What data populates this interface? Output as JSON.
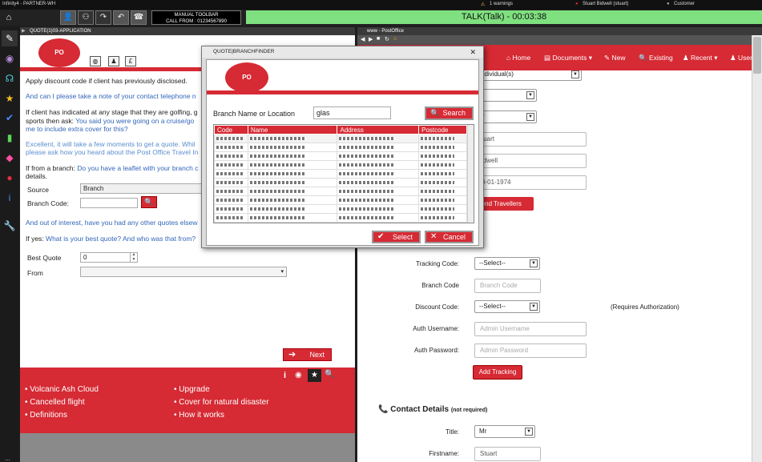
{
  "topbar": {
    "app_title": "Infinity4 - PARTNER-WH",
    "warnings": "1 warnings",
    "user": "Stuart Bidwell (stuart)",
    "customer": "Customer"
  },
  "toolbar": {
    "manual_label": "MANUAL TOOLBAR",
    "call_from": "CALL FROM : 01234567890",
    "talk_status": "TALK(Talk) - 00:03:38"
  },
  "left_panel": {
    "tab_title": "QUOTE(1)03-APPLICATION",
    "currency_icon": "£",
    "paragraphs": {
      "p1": "Apply discount code if client has previously disclosed.",
      "p2": "And can I please take a note of your contact telephone n",
      "p3a": "If client has indicated at any stage that they are golfing, g",
      "p3b": "sports then ask: ",
      "p3c": "You said you were going on a cruise/go",
      "p3d": "me to include extra cover for this?",
      "p4a": "Excellent, it will take a few moments to get a quote.  Whil",
      "p4b": "please ask how you heard about the Post Office Travel In",
      "p5a": "If from a branch: ",
      "p5b": "Do you have a leaflet with your branch c",
      "p5c": "details.",
      "p6": "And out of interest, have you had any other quotes elsew",
      "p7a": "If yes: ",
      "p7b": "What is your best quote?  And who was that from?"
    },
    "source_label": "Source",
    "source_value": "Branch",
    "branch_code_label": "Branch Code:",
    "best_quote_label": "Best Quote",
    "best_quote_value": "0",
    "from_label": "From",
    "next_label": "Next",
    "footer_left": [
      "Volcanic Ash Cloud",
      "Cancelled flight",
      "Definitions"
    ],
    "footer_right": [
      "Upgrade",
      "Cover for natural disaster",
      "How it works"
    ]
  },
  "right_panel": {
    "tab_title": "www - PostOffice",
    "nav": {
      "home": "Home",
      "documents": "Documents",
      "new": "New",
      "existing": "Existing",
      "recent": "Recent",
      "user": "User"
    },
    "top_fields": {
      "individual": "ndividual(s)",
      "title_short": "Ir",
      "firstname": "tuart",
      "surname": "idwell",
      "dob": "0-01-1974",
      "amend_travellers": "mend Travellers"
    },
    "tracking_code_label": "Tracking Code:",
    "tracking_code_value": "--Select--",
    "branch_code_label": "Branch Code",
    "branch_code_placeholder": "Branch Code",
    "discount_code_label": "Discount Code:",
    "discount_code_value": "--Select--",
    "requires_auth": "(Requires Authorization)",
    "auth_username_label": "Auth Username:",
    "auth_username_placeholder": "Admin Username",
    "auth_password_label": "Auth Password:",
    "auth_password_placeholder": "Admin Password",
    "add_tracking": "Add Tracking",
    "contact_details": "Contact Details",
    "not_required": "(not required)",
    "title_label": "Title:",
    "title_value": "Mr",
    "firstname_label": "Firstname:",
    "firstname_value": "Stuart"
  },
  "modal": {
    "title": "QUOTE|BRANCHFINDER",
    "search_label": "Branch Name or Location",
    "search_value": "glas",
    "search_button": "Search",
    "columns": [
      "Code",
      "Name",
      "Address",
      "Postcode"
    ],
    "select_button": "Select",
    "cancel_button": "Cancel"
  },
  "colors": {
    "brand_red": "#d62a34",
    "talk_green": "#7fe07f",
    "link_blue": "#3366bb"
  }
}
